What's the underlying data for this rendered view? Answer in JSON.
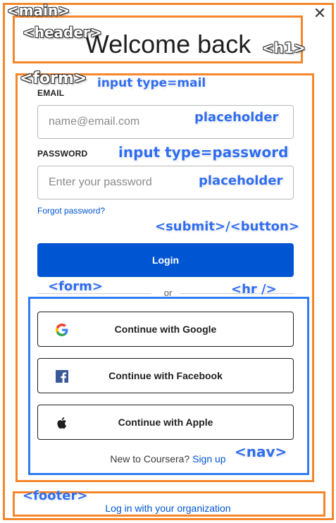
{
  "header": {
    "title": "Welcome back",
    "close_icon": "close-icon"
  },
  "form": {
    "email_label": "EMAIL",
    "email_placeholder": "name@email.com",
    "password_label": "PASSWORD",
    "password_placeholder": "Enter your password",
    "forgot_link": "Forgot password?",
    "login_button": "Login",
    "divider_text": "or"
  },
  "social": [
    {
      "label": "Continue with Google",
      "icon": "google-icon"
    },
    {
      "label": "Continue with Facebook",
      "icon": "facebook-icon"
    },
    {
      "label": "Continue with Apple",
      "icon": "apple-icon"
    }
  ],
  "nav": {
    "prompt": "New to Coursera?",
    "signup_link": "Sign up"
  },
  "footer": {
    "org_link": "Log in with your organization"
  },
  "annotations": {
    "main": "<main>",
    "header": "<header>",
    "h1": "<h1>",
    "form": "<form>",
    "input_email": "input type=mail",
    "placeholder_email": "placeholder",
    "input_password": "input type=password",
    "placeholder_password": "placeholder",
    "submit": "<submit>/<button>",
    "form2": "<form>",
    "hr": "<hr />",
    "nav": "<nav>",
    "footer": "<footer>"
  },
  "colors": {
    "annotation_orange": "#f5862b",
    "annotation_blue": "#2f7df0",
    "brand_blue": "#0056d2"
  }
}
